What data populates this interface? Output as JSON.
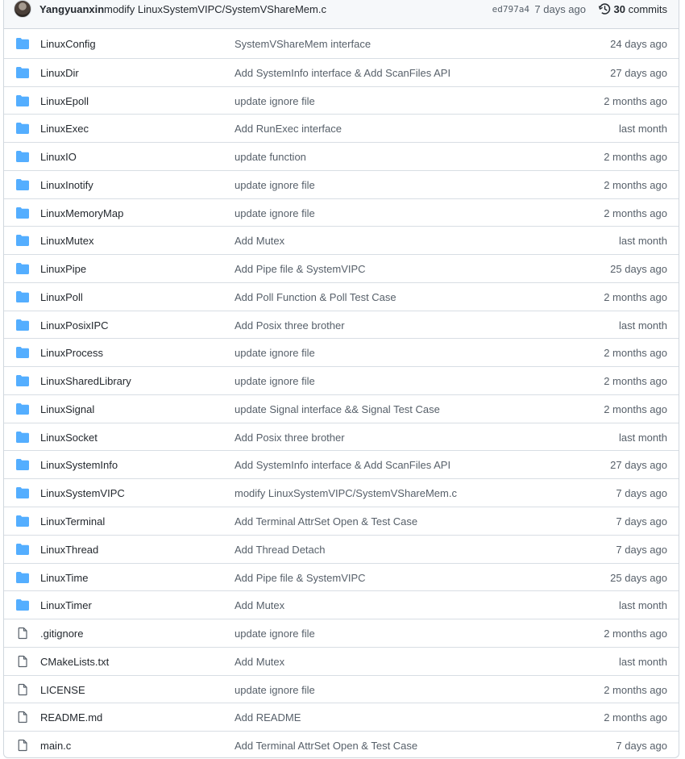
{
  "header": {
    "author": "Yangyuanxin",
    "commit_message": "modify LinuxSystemVIPC/SystemVShareMem.c",
    "sha": "ed797a4",
    "time": "7 days ago",
    "commits_count": "30",
    "commits_label": "commits"
  },
  "colors": {
    "folder": "#54aeff",
    "file": "#57606a",
    "border": "#d0d7de",
    "header_bg": "#f6f8fa"
  },
  "files": [
    {
      "type": "folder",
      "name": "LinuxConfig",
      "message": "SystemVShareMem interface",
      "age": "24 days ago"
    },
    {
      "type": "folder",
      "name": "LinuxDir",
      "message": "Add SystemInfo interface & Add ScanFiles API",
      "age": "27 days ago"
    },
    {
      "type": "folder",
      "name": "LinuxEpoll",
      "message": "update ignore file",
      "age": "2 months ago"
    },
    {
      "type": "folder",
      "name": "LinuxExec",
      "message": "Add RunExec interface",
      "age": "last month"
    },
    {
      "type": "folder",
      "name": "LinuxIO",
      "message": "update function",
      "age": "2 months ago"
    },
    {
      "type": "folder",
      "name": "LinuxInotify",
      "message": "update ignore file",
      "age": "2 months ago"
    },
    {
      "type": "folder",
      "name": "LinuxMemoryMap",
      "message": "update ignore file",
      "age": "2 months ago"
    },
    {
      "type": "folder",
      "name": "LinuxMutex",
      "message": "Add Mutex",
      "age": "last month"
    },
    {
      "type": "folder",
      "name": "LinuxPipe",
      "message": "Add Pipe file & SystemVIPC",
      "age": "25 days ago"
    },
    {
      "type": "folder",
      "name": "LinuxPoll",
      "message": "Add Poll Function & Poll Test Case",
      "age": "2 months ago"
    },
    {
      "type": "folder",
      "name": "LinuxPosixIPC",
      "message": "Add Posix three brother",
      "age": "last month"
    },
    {
      "type": "folder",
      "name": "LinuxProcess",
      "message": "update ignore file",
      "age": "2 months ago"
    },
    {
      "type": "folder",
      "name": "LinuxSharedLibrary",
      "message": "update ignore file",
      "age": "2 months ago"
    },
    {
      "type": "folder",
      "name": "LinuxSignal",
      "message": "update Signal interface && Signal Test Case",
      "age": "2 months ago"
    },
    {
      "type": "folder",
      "name": "LinuxSocket",
      "message": "Add Posix three brother",
      "age": "last month"
    },
    {
      "type": "folder",
      "name": "LinuxSystemInfo",
      "message": "Add SystemInfo interface & Add ScanFiles API",
      "age": "27 days ago"
    },
    {
      "type": "folder",
      "name": "LinuxSystemVIPC",
      "message": "modify LinuxSystemVIPC/SystemVShareMem.c",
      "age": "7 days ago"
    },
    {
      "type": "folder",
      "name": "LinuxTerminal",
      "message": "Add Terminal AttrSet Open & Test Case",
      "age": "7 days ago"
    },
    {
      "type": "folder",
      "name": "LinuxThread",
      "message": "Add Thread Detach",
      "age": "7 days ago"
    },
    {
      "type": "folder",
      "name": "LinuxTime",
      "message": "Add Pipe file & SystemVIPC",
      "age": "25 days ago"
    },
    {
      "type": "folder",
      "name": "LinuxTimer",
      "message": "Add Mutex",
      "age": "last month"
    },
    {
      "type": "file",
      "name": ".gitignore",
      "message": "update ignore file",
      "age": "2 months ago"
    },
    {
      "type": "file",
      "name": "CMakeLists.txt",
      "message": "Add Mutex",
      "age": "last month"
    },
    {
      "type": "file",
      "name": "LICENSE",
      "message": "update ignore file",
      "age": "2 months ago"
    },
    {
      "type": "file",
      "name": "README.md",
      "message": "Add README",
      "age": "2 months ago"
    },
    {
      "type": "file",
      "name": "main.c",
      "message": "Add Terminal AttrSet Open & Test Case",
      "age": "7 days ago"
    }
  ]
}
